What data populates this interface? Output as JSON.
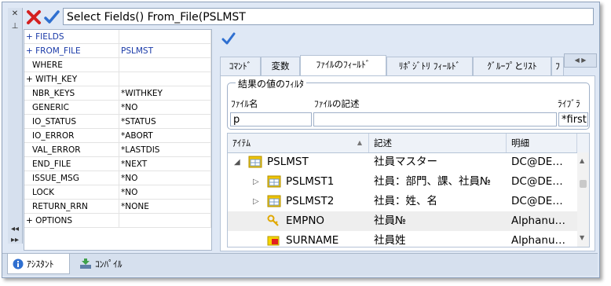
{
  "toolbar": {
    "command_text": "Select Fields() From_File(PSLMST"
  },
  "left_vertical_buttons": [
    "✕",
    "⊥",
    "◂◂",
    "▸▸"
  ],
  "property_grid": [
    {
      "key": "+ FIELDS",
      "value": "",
      "highlight": true
    },
    {
      "key": "+ FROM_FILE",
      "value": "PSLMST",
      "highlight": true,
      "value_blue": true
    },
    {
      "key": "WHERE",
      "value": ""
    },
    {
      "key": "+ WITH_KEY",
      "value": ""
    },
    {
      "key": "NBR_KEYS",
      "value": "*WITHKEY"
    },
    {
      "key": "GENERIC",
      "value": "*NO"
    },
    {
      "key": "IO_STATUS",
      "value": "*STATUS"
    },
    {
      "key": "IO_ERROR",
      "value": "*ABORT"
    },
    {
      "key": "VAL_ERROR",
      "value": "*LASTDIS"
    },
    {
      "key": "END_FILE",
      "value": "*NEXT"
    },
    {
      "key": "ISSUE_MSG",
      "value": "*NO"
    },
    {
      "key": "LOCK",
      "value": "*NO"
    },
    {
      "key": "RETURN_RRN",
      "value": "*NONE"
    },
    {
      "key": "+ OPTIONS",
      "value": ""
    }
  ],
  "tabs": [
    {
      "label": "ｺﾏﾝﾄﾞ",
      "active": false
    },
    {
      "label": "変数",
      "active": false
    },
    {
      "label": "ﾌｧｲﾙのﾌｨｰﾙﾄﾞ",
      "active": true
    },
    {
      "label": "ﾘﾎﾟｼﾞﾄﾘ ﾌｨｰﾙﾄﾞ",
      "active": false
    },
    {
      "label": "ｸﾞﾙｰﾌﾟとﾘｽﾄ",
      "active": false
    },
    {
      "label": "ﾌ",
      "active": false
    }
  ],
  "filter": {
    "legend": "結果の値のﾌｨﾙﾀ",
    "file_name_label": "ﾌｧｲﾙ名",
    "file_desc_label": "ﾌｧｲﾙの記述",
    "library_label": "ﾗｲﾌﾞﾗ",
    "file_name_value": "p",
    "file_desc_value": "",
    "library_value": "*first"
  },
  "list": {
    "headers": [
      "ｱｲﾃﾑ",
      "記述",
      "明細"
    ],
    "rows": [
      {
        "expander": "◢",
        "indent": 0,
        "icon": "table-icon",
        "name": "PSLMST",
        "desc": "社員マスター",
        "detail": "DC@DE…",
        "highlight": false
      },
      {
        "expander": "▷",
        "indent": 1,
        "icon": "table-icon",
        "name": "PSLMST1",
        "desc": "社員：部門、課、社員№",
        "detail": "DC@DE…",
        "highlight": false
      },
      {
        "expander": "▷",
        "indent": 1,
        "icon": "table-icon",
        "name": "PSLMST2",
        "desc": "社員：姓、名",
        "detail": "DC@DE…",
        "highlight": false
      },
      {
        "expander": "",
        "indent": 1,
        "icon": "key-icon",
        "name": "EMPNO",
        "desc": "社員№",
        "detail": "Alphanu…",
        "highlight": true
      },
      {
        "expander": "",
        "indent": 1,
        "icon": "field-icon",
        "name": "SURNAME",
        "desc": "社員姓",
        "detail": "Alphanu…",
        "highlight": false
      }
    ]
  },
  "bottom_tabs": [
    {
      "label": "ｱｼｽﾀﾝﾄ",
      "icon": "info-icon",
      "active": true
    },
    {
      "label": "ｺﾝﾊﾟｲﾙ",
      "icon": "compile-icon",
      "active": false
    }
  ],
  "colors": {
    "accent_blue": "#1a3aa8",
    "cancel_red": "#d42020",
    "ok_blue": "#2f6fd0"
  }
}
